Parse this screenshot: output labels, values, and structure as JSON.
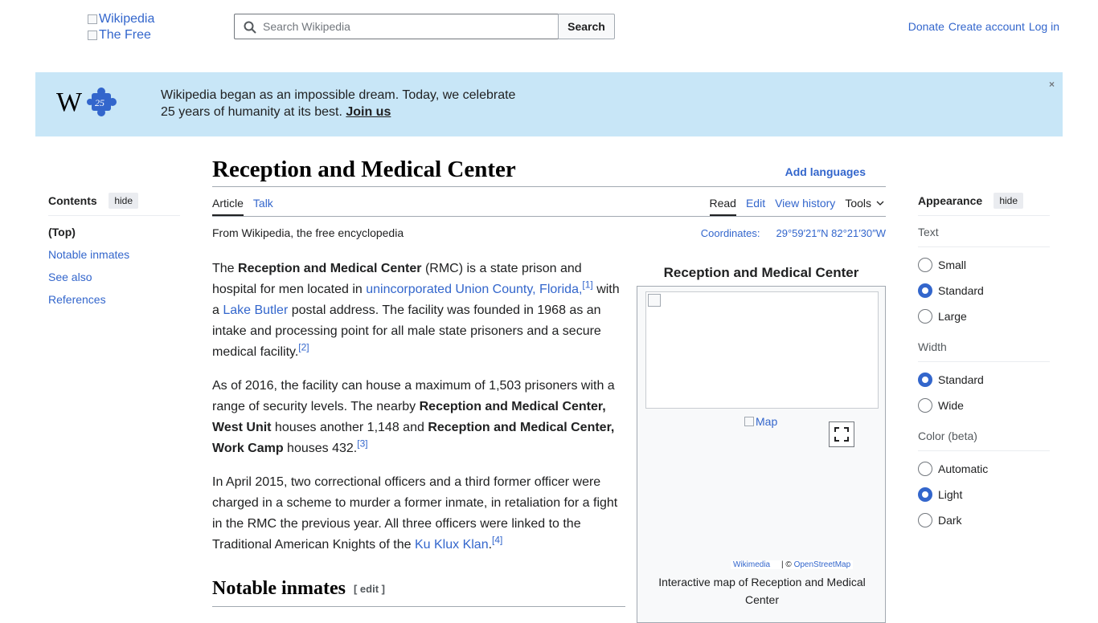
{
  "header": {
    "logo_alt_1": "Wikipedia",
    "logo_alt_2": "The Free",
    "search_placeholder": "Search Wikipedia",
    "search_button": "Search",
    "user_links": [
      "Donate",
      "Create account",
      "Log in"
    ]
  },
  "banner": {
    "line1": "Wikipedia began as an impossible dream. Today, we celebrate",
    "line2": "25 years of humanity at its best.",
    "link": "Join us",
    "close": "×"
  },
  "toc": {
    "title": "Contents",
    "hide": "hide",
    "items": [
      "(Top)",
      "Notable inmates",
      "See also",
      "References"
    ]
  },
  "article": {
    "title": "Reception and Medical Center",
    "add_languages": "Add languages",
    "tabs_left": [
      "Article",
      "Talk"
    ],
    "tabs_right": [
      "Read",
      "Edit",
      "View history"
    ],
    "tools": "Tools",
    "from": "From Wikipedia, the free encyclopedia",
    "coordinates_label": "Coordinates:",
    "coordinates_value": "29°59′21″N 82°21′30″W",
    "p1": {
      "a": "The ",
      "b": "Reception and Medical Center",
      "c": " (RMC) is a state prison and hospital for men located in ",
      "link1": "unincorporated Union County, Florida,",
      "ref1": "[1]",
      "d": " with a ",
      "link2": "Lake Butler",
      "e": " postal address. The facility was founded in 1968 as an intake and processing point for all male state prisoners and a secure medical facility.",
      "ref2": "[2]"
    },
    "p2": {
      "a": "As of 2016, the facility can house a maximum of 1,503 prisoners with a range of security levels. The nearby ",
      "b": "Reception and Medical Center, West Unit",
      "c": " houses another 1,148 and ",
      "d": "Reception and Medical Center, Work Camp",
      "e": " houses 432.",
      "ref3": "[3]"
    },
    "p3": {
      "a": "In April 2015, two correctional officers and a third former officer were charged in a scheme to murder a former inmate, in retaliation for a fight in the RMC the previous year. All three officers were linked to the Traditional American Knights of the ",
      "link": "Ku Klux Klan",
      "b": ".",
      "ref4": "[4]"
    },
    "h2": "Notable inmates",
    "h2_edit": "[ edit ]"
  },
  "infobox": {
    "caption": "Reception and Medical Center",
    "map_alt": "Map",
    "attr_wikimedia": "Wikimedia",
    "attr_sep": "| ©",
    "attr_osm": "OpenStreetMap",
    "map_caption": "Interactive map of Reception and Medical Center"
  },
  "appearance": {
    "title": "Appearance",
    "hide": "hide",
    "text_label": "Text",
    "text_options": [
      "Small",
      "Standard",
      "Large"
    ],
    "text_selected": "Standard",
    "width_label": "Width",
    "width_options": [
      "Standard",
      "Wide"
    ],
    "width_selected": "Standard",
    "color_label": "Color (beta)",
    "color_options": [
      "Automatic",
      "Light",
      "Dark"
    ],
    "color_selected": "Light"
  },
  "colors": {
    "link": "#3366cc",
    "banner_bg": "#c8e6f7",
    "text": "#202122"
  }
}
